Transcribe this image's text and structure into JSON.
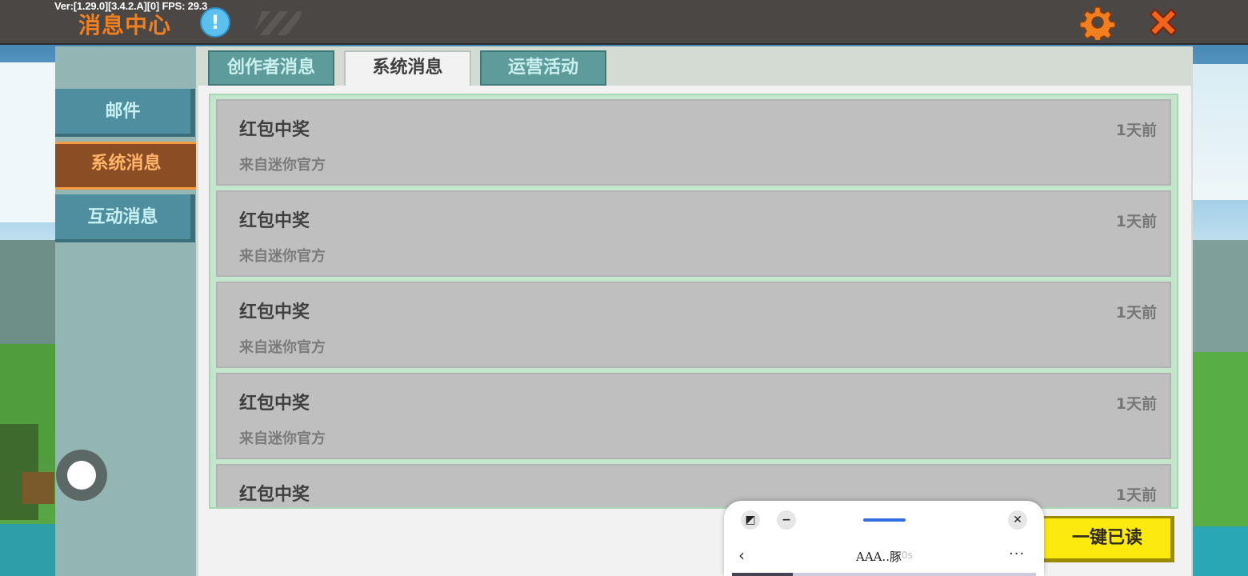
{
  "topbar": {
    "version": "Ver:[1.29.0][3.4.2.A][0] FPS: 29.3",
    "title": "消息中心",
    "info_glyph": "!"
  },
  "icons": {
    "info": "info-icon",
    "settings": "gear-icon",
    "close": "close-icon"
  },
  "colors": {
    "accent_orange": "#f07f1f",
    "sidebar_button": "#4f8e9e",
    "sidebar_active": "#8a4d24",
    "tab": "#5d9c9a",
    "read_all_button": "#fce90e"
  },
  "sidebar": {
    "items": [
      {
        "label": "邮件",
        "active": false
      },
      {
        "label": "系统消息",
        "active": true
      },
      {
        "label": "互动消息",
        "active": false
      }
    ]
  },
  "tabs": [
    {
      "label": "创作者消息",
      "active": false
    },
    {
      "label": "系统消息",
      "active": true
    },
    {
      "label": "运营活动",
      "active": false
    }
  ],
  "messages": [
    {
      "title": "红包中奖",
      "source": "来自迷你官方",
      "time": "1天前"
    },
    {
      "title": "红包中奖",
      "source": "来自迷你官方",
      "time": "1天前"
    },
    {
      "title": "红包中奖",
      "source": "来自迷你官方",
      "time": "1天前"
    },
    {
      "title": "红包中奖",
      "source": "来自迷你官方",
      "time": "1天前"
    },
    {
      "title": "红包中奖",
      "source": "",
      "time": "1天前"
    }
  ],
  "read_all_label": "一键已读",
  "floating_window": {
    "title": "AAA..豚",
    "badge": "0s",
    "expand_glyph": "◩",
    "minimize_glyph": "−",
    "close_glyph": "✕",
    "back_glyph": "‹",
    "more_glyph": "···"
  }
}
